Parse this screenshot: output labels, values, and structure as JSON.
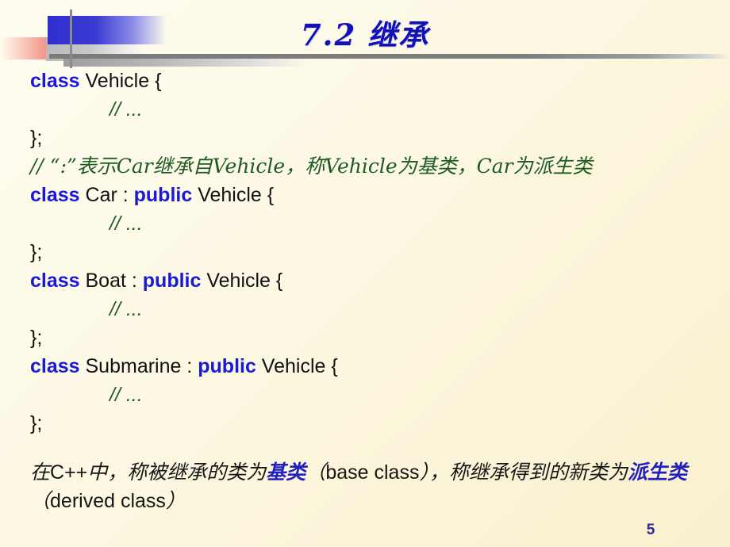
{
  "slide": {
    "title_number": "7.2",
    "title_text": "继承",
    "page_number": "5",
    "background_color": "#fdf9e6",
    "accent_colors": {
      "title_blue": "#1111bb",
      "keyword_blue": "#1a1ad6",
      "comment_green": "#1e5b22",
      "deco_blue": "#2f2fce",
      "deco_red": "#f4453a",
      "deco_gold": "#fcc13d",
      "deco_gray": "#7b7b7b",
      "highlight_blue": "#1f1fc2"
    }
  },
  "code": {
    "lines": [
      {
        "keyword": "class",
        "rest": " Vehicle {",
        "indent": false
      },
      {
        "comment": "// ...",
        "indent": true
      },
      {
        "rest": "};",
        "indent": false
      },
      {
        "comment_cn": "// “:”表示Car继承自Vehicle，称Vehicle为基类，Car为派生类",
        "indent": false
      },
      {
        "keyword": "class",
        "rest": " Car : ",
        "keyword2": "public",
        "rest2": " Vehicle {",
        "indent": false
      },
      {
        "comment": "// ...",
        "indent": true
      },
      {
        "rest": "};",
        "indent": false
      },
      {
        "keyword": "class",
        "rest": " Boat : ",
        "keyword2": "public",
        "rest2": " Vehicle {",
        "indent": false
      },
      {
        "comment": "// ...",
        "indent": true
      },
      {
        "rest": "};",
        "indent": false
      },
      {
        "keyword": "class",
        "rest": " Submarine : ",
        "keyword2": "public",
        "rest2": " Vehicle {",
        "indent": false
      },
      {
        "comment": "// ...",
        "indent": true
      },
      {
        "rest": "};",
        "indent": false
      }
    ]
  },
  "paragraph": {
    "part1": "在",
    "part1_en": "C++",
    "part2": "中，称被继承的类为",
    "highlight1": "基类",
    "paren_open": "（",
    "term1_en": "base class",
    "paren_close": "）",
    "part3": "，称继承得到的新类为",
    "highlight2": "派生类",
    "paren_open2": "（",
    "term2_en": "derived class",
    "paren_close2": "）"
  }
}
